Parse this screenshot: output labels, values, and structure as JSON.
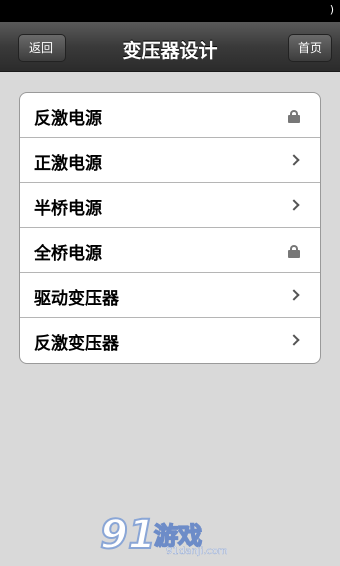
{
  "status_bar": {
    "glyph": ")"
  },
  "nav": {
    "back_label": "返回",
    "title": "变压器设计",
    "home_label": "首页"
  },
  "list": {
    "items": [
      {
        "label": "反激电源",
        "indicator": "lock-icon"
      },
      {
        "label": "正激电源",
        "indicator": "chevron-right-icon"
      },
      {
        "label": "半桥电源",
        "indicator": "chevron-right-icon"
      },
      {
        "label": "全桥电源",
        "indicator": "lock-icon"
      },
      {
        "label": "驱动变压器",
        "indicator": "chevron-right-icon"
      },
      {
        "label": "反激变压器",
        "indicator": "chevron-right-icon"
      }
    ]
  },
  "watermark": {
    "number": "91",
    "text": "游戏",
    "url": "91danji.com"
  }
}
